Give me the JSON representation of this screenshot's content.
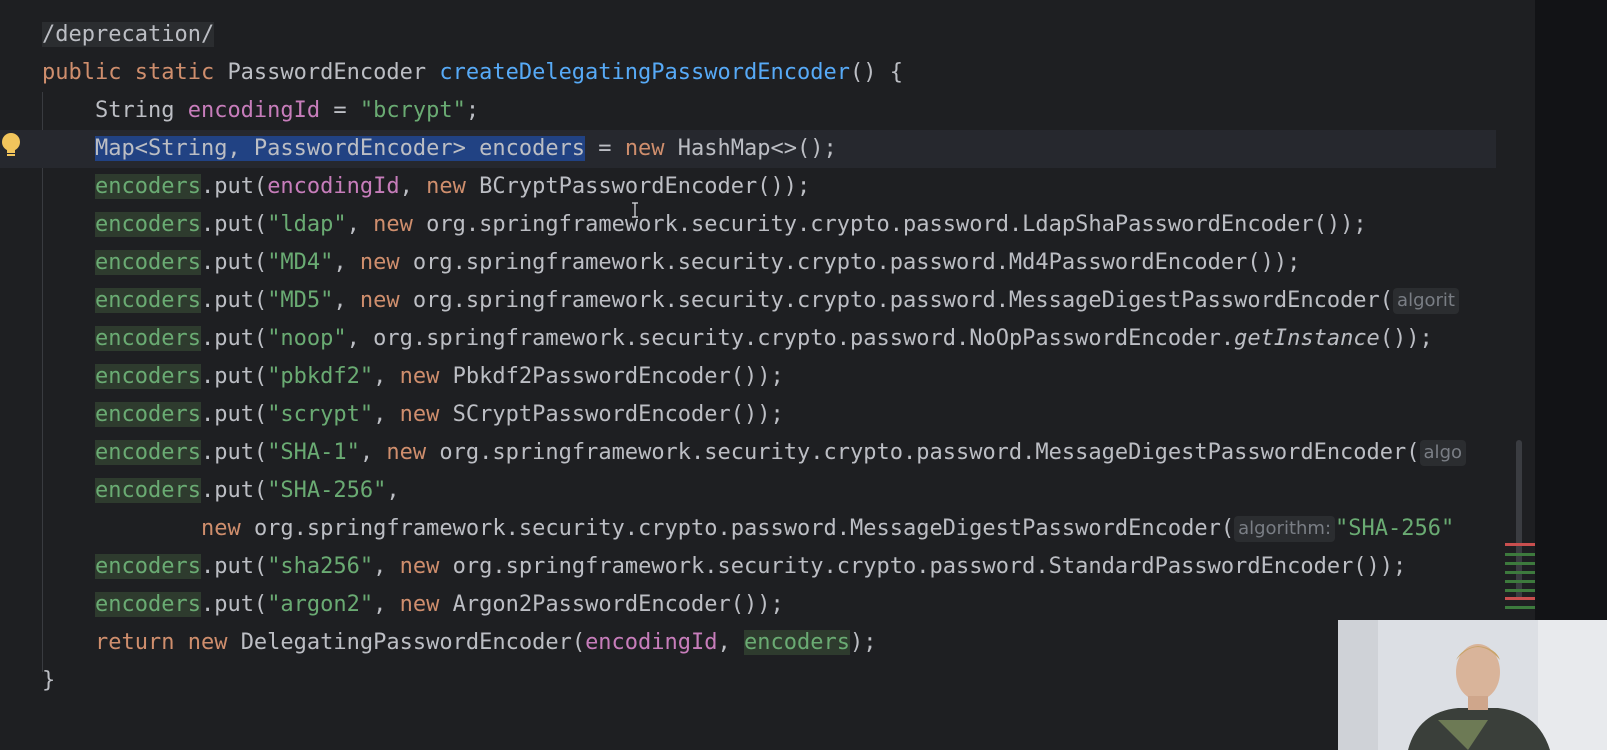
{
  "editor": {
    "lines": [
      {
        "id": "deprecation-comment",
        "parts": [
          {
            "t": "/deprecation/",
            "c": "cm"
          }
        ]
      },
      {
        "id": "method-signature",
        "parts": [
          {
            "t": "public static ",
            "c": "kw"
          },
          {
            "t": "PasswordEncoder ",
            "c": "var"
          },
          {
            "t": "createDelegatingPasswordEncoder",
            "c": "fnname"
          },
          {
            "t": "() ",
            "c": "var"
          },
          {
            "t": "{",
            "c": "brace"
          }
        ]
      },
      {
        "id": "encoding-id-decl",
        "parts": [
          {
            "t": "    String ",
            "c": "var"
          },
          {
            "t": "encodingId",
            "c": "fld"
          },
          {
            "t": " = ",
            "c": "var"
          },
          {
            "t": "\"bcrypt\"",
            "c": "str"
          },
          {
            "t": ";",
            "c": "var"
          }
        ]
      },
      {
        "id": "encoders-decl",
        "parts": [
          {
            "t": "    ",
            "c": "var"
          },
          {
            "t": "Map<String, PasswordEncoder> encoders",
            "c": "sel"
          },
          {
            "t": " = ",
            "c": "var"
          },
          {
            "t": "new ",
            "c": "kw"
          },
          {
            "t": "HashMap<>();",
            "c": "var"
          }
        ]
      },
      {
        "id": "put-bcrypt",
        "parts": [
          {
            "t": "    ",
            "c": "var"
          },
          {
            "t": "encoders",
            "c": "usage"
          },
          {
            "t": ".put(",
            "c": "var"
          },
          {
            "t": "encodingId",
            "c": "fld"
          },
          {
            "t": ", ",
            "c": "var"
          },
          {
            "t": "new ",
            "c": "kw"
          },
          {
            "t": "BCryptPasswordEncoder());",
            "c": "var"
          }
        ]
      },
      {
        "id": "put-ldap",
        "parts": [
          {
            "t": "    ",
            "c": "var"
          },
          {
            "t": "encoders",
            "c": "usage"
          },
          {
            "t": ".put(",
            "c": "var"
          },
          {
            "t": "\"ldap\"",
            "c": "str"
          },
          {
            "t": ", ",
            "c": "var"
          },
          {
            "t": "new ",
            "c": "kw"
          },
          {
            "t": "org.springframework.security.crypto.password.LdapShaPasswordEncoder());",
            "c": "var"
          }
        ]
      },
      {
        "id": "put-md4",
        "parts": [
          {
            "t": "    ",
            "c": "var"
          },
          {
            "t": "encoders",
            "c": "usage"
          },
          {
            "t": ".put(",
            "c": "var"
          },
          {
            "t": "\"MD4\"",
            "c": "str"
          },
          {
            "t": ", ",
            "c": "var"
          },
          {
            "t": "new ",
            "c": "kw"
          },
          {
            "t": "org.springframework.security.crypto.password.Md4PasswordEncoder());",
            "c": "var"
          }
        ]
      },
      {
        "id": "put-md5",
        "parts": [
          {
            "t": "    ",
            "c": "var"
          },
          {
            "t": "encoders",
            "c": "usage"
          },
          {
            "t": ".put(",
            "c": "var"
          },
          {
            "t": "\"MD5\"",
            "c": "str"
          },
          {
            "t": ", ",
            "c": "var"
          },
          {
            "t": "new ",
            "c": "kw"
          },
          {
            "t": "org.springframework.security.crypto.password.MessageDigestPasswordEncoder(",
            "c": "var"
          },
          {
            "t": "algorit",
            "c": "hint"
          }
        ]
      },
      {
        "id": "put-noop",
        "parts": [
          {
            "t": "    ",
            "c": "var"
          },
          {
            "t": "encoders",
            "c": "usage"
          },
          {
            "t": ".put(",
            "c": "var"
          },
          {
            "t": "\"noop\"",
            "c": "str"
          },
          {
            "t": ", ",
            "c": "var"
          },
          {
            "t": "org.springframework.security.crypto.password.NoOpPasswordEncoder.",
            "c": "var"
          },
          {
            "t": "getInstance",
            "c": "ital"
          },
          {
            "t": "());",
            "c": "var"
          }
        ]
      },
      {
        "id": "put-pbkdf2",
        "parts": [
          {
            "t": "    ",
            "c": "var"
          },
          {
            "t": "encoders",
            "c": "usage"
          },
          {
            "t": ".put(",
            "c": "var"
          },
          {
            "t": "\"pbkdf2\"",
            "c": "str"
          },
          {
            "t": ", ",
            "c": "var"
          },
          {
            "t": "new ",
            "c": "kw"
          },
          {
            "t": "Pbkdf2PasswordEncoder());",
            "c": "var"
          }
        ]
      },
      {
        "id": "put-scrypt",
        "parts": [
          {
            "t": "    ",
            "c": "var"
          },
          {
            "t": "encoders",
            "c": "usage"
          },
          {
            "t": ".put(",
            "c": "var"
          },
          {
            "t": "\"scrypt\"",
            "c": "str"
          },
          {
            "t": ", ",
            "c": "var"
          },
          {
            "t": "new ",
            "c": "kw"
          },
          {
            "t": "SCryptPasswordEncoder());",
            "c": "var"
          }
        ]
      },
      {
        "id": "put-sha1",
        "parts": [
          {
            "t": "    ",
            "c": "var"
          },
          {
            "t": "encoders",
            "c": "usage"
          },
          {
            "t": ".put(",
            "c": "var"
          },
          {
            "t": "\"SHA-1\"",
            "c": "str"
          },
          {
            "t": ", ",
            "c": "var"
          },
          {
            "t": "new ",
            "c": "kw"
          },
          {
            "t": "org.springframework.security.crypto.password.MessageDigestPasswordEncoder(",
            "c": "var"
          },
          {
            "t": "algo",
            "c": "hint"
          }
        ]
      },
      {
        "id": "put-sha256",
        "parts": [
          {
            "t": "    ",
            "c": "var"
          },
          {
            "t": "encoders",
            "c": "usage"
          },
          {
            "t": ".put(",
            "c": "var"
          },
          {
            "t": "\"SHA-256\"",
            "c": "str"
          },
          {
            "t": ",",
            "c": "var"
          }
        ]
      },
      {
        "id": "put-sha256-cont",
        "parts": [
          {
            "t": "            ",
            "c": "var"
          },
          {
            "t": "new ",
            "c": "kw"
          },
          {
            "t": "org.springframework.security.crypto.password.MessageDigestPasswordEncoder(",
            "c": "var"
          },
          {
            "t": "algorithm:",
            "c": "hintlabel"
          },
          {
            "t": "\"SHA-256\"",
            "c": "hintval"
          }
        ]
      },
      {
        "id": "put-sha256-std",
        "parts": [
          {
            "t": "    ",
            "c": "var"
          },
          {
            "t": "encoders",
            "c": "usage"
          },
          {
            "t": ".put(",
            "c": "var"
          },
          {
            "t": "\"sha256\"",
            "c": "str"
          },
          {
            "t": ", ",
            "c": "var"
          },
          {
            "t": "new ",
            "c": "kw"
          },
          {
            "t": "org.springframework.security.crypto.password.StandardPasswordEncoder());",
            "c": "var"
          }
        ]
      },
      {
        "id": "put-argon2",
        "parts": [
          {
            "t": "    ",
            "c": "var"
          },
          {
            "t": "encoders",
            "c": "usage"
          },
          {
            "t": ".put(",
            "c": "var"
          },
          {
            "t": "\"argon2\"",
            "c": "str"
          },
          {
            "t": ", ",
            "c": "var"
          },
          {
            "t": "new ",
            "c": "kw"
          },
          {
            "t": "Argon2PasswordEncoder());",
            "c": "var"
          }
        ]
      },
      {
        "id": "return-stmt",
        "parts": [
          {
            "t": "    ",
            "c": "var"
          },
          {
            "t": "return new ",
            "c": "kw"
          },
          {
            "t": "DelegatingPasswordEncoder(",
            "c": "var"
          },
          {
            "t": "encodingId",
            "c": "fld"
          },
          {
            "t": ", ",
            "c": "var"
          },
          {
            "t": "encoders",
            "c": "usage"
          },
          {
            "t": ");",
            "c": "var"
          }
        ]
      },
      {
        "id": "closing-brace",
        "parts": [
          {
            "t": "}",
            "c": "brace"
          }
        ]
      }
    ]
  },
  "colors": {
    "background": "#1e1f22",
    "keyword": "#cf8e6d",
    "string": "#6aab73",
    "field": "#c77dbb",
    "method_name": "#56a8f5",
    "selection": "#214283"
  }
}
